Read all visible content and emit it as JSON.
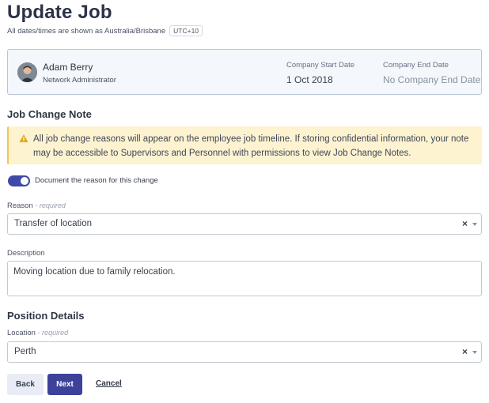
{
  "header": {
    "title": "Update Job",
    "timezone_note": "All dates/times are shown as Australia/Brisbane",
    "timezone_badge": "UTC+10"
  },
  "employee": {
    "name": "Adam Berry",
    "role": "Network Administrator",
    "start_label": "Company Start Date",
    "start_value": "1 Oct 2018",
    "end_label": "Company End Date",
    "end_value": "No Company End Date"
  },
  "job_change": {
    "heading": "Job Change Note",
    "warning": "All job change reasons will appear on the employee job timeline. If storing confidential information, your note may be accessible to Supervisors and Personnel with permissions to view Job Change Notes.",
    "toggle_label": "Document the reason for this change",
    "toggle_on": true,
    "reason_label": "Reason",
    "reason_required": "- required",
    "reason_value": "Transfer of location",
    "description_label": "Description",
    "description_value": "Moving location due to family relocation."
  },
  "position": {
    "heading": "Position Details",
    "location_label": "Location",
    "location_required": "- required",
    "location_value": "Perth"
  },
  "actions": {
    "back": "Back",
    "next": "Next",
    "cancel": "Cancel"
  },
  "colors": {
    "primary": "#3c4299",
    "warning_bg": "#fdf3d1",
    "card_bg": "#f4f7fb"
  }
}
